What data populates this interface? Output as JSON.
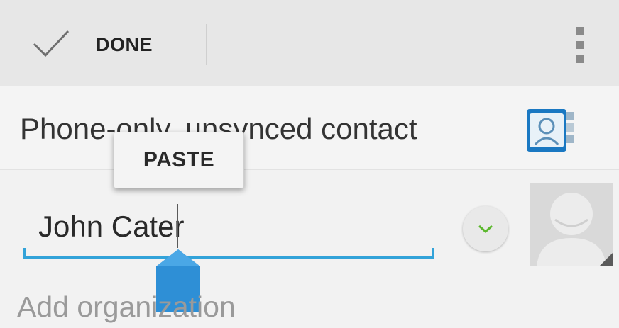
{
  "actionbar": {
    "done_label": "DONE",
    "done_icon": "check-icon",
    "overflow_icon": "overflow-menu-icon"
  },
  "account": {
    "label": "Phone-only, unsynced contact",
    "icon": "contacts-app-icon"
  },
  "name_field": {
    "value": "John Cater"
  },
  "text_selection": {
    "popup_action": "PASTE",
    "handle_color": "#2e8fd6"
  },
  "expand_button": {
    "icon": "chevron-down-icon"
  },
  "photo": {
    "icon": "default-avatar-icon"
  },
  "add_organization": {
    "label": "Add organization"
  },
  "colors": {
    "accent": "#33a3d9",
    "chevron": "#5cb82e",
    "actionbar_bg": "#e7e7e7",
    "screen_bg": "#f2f2f2"
  }
}
